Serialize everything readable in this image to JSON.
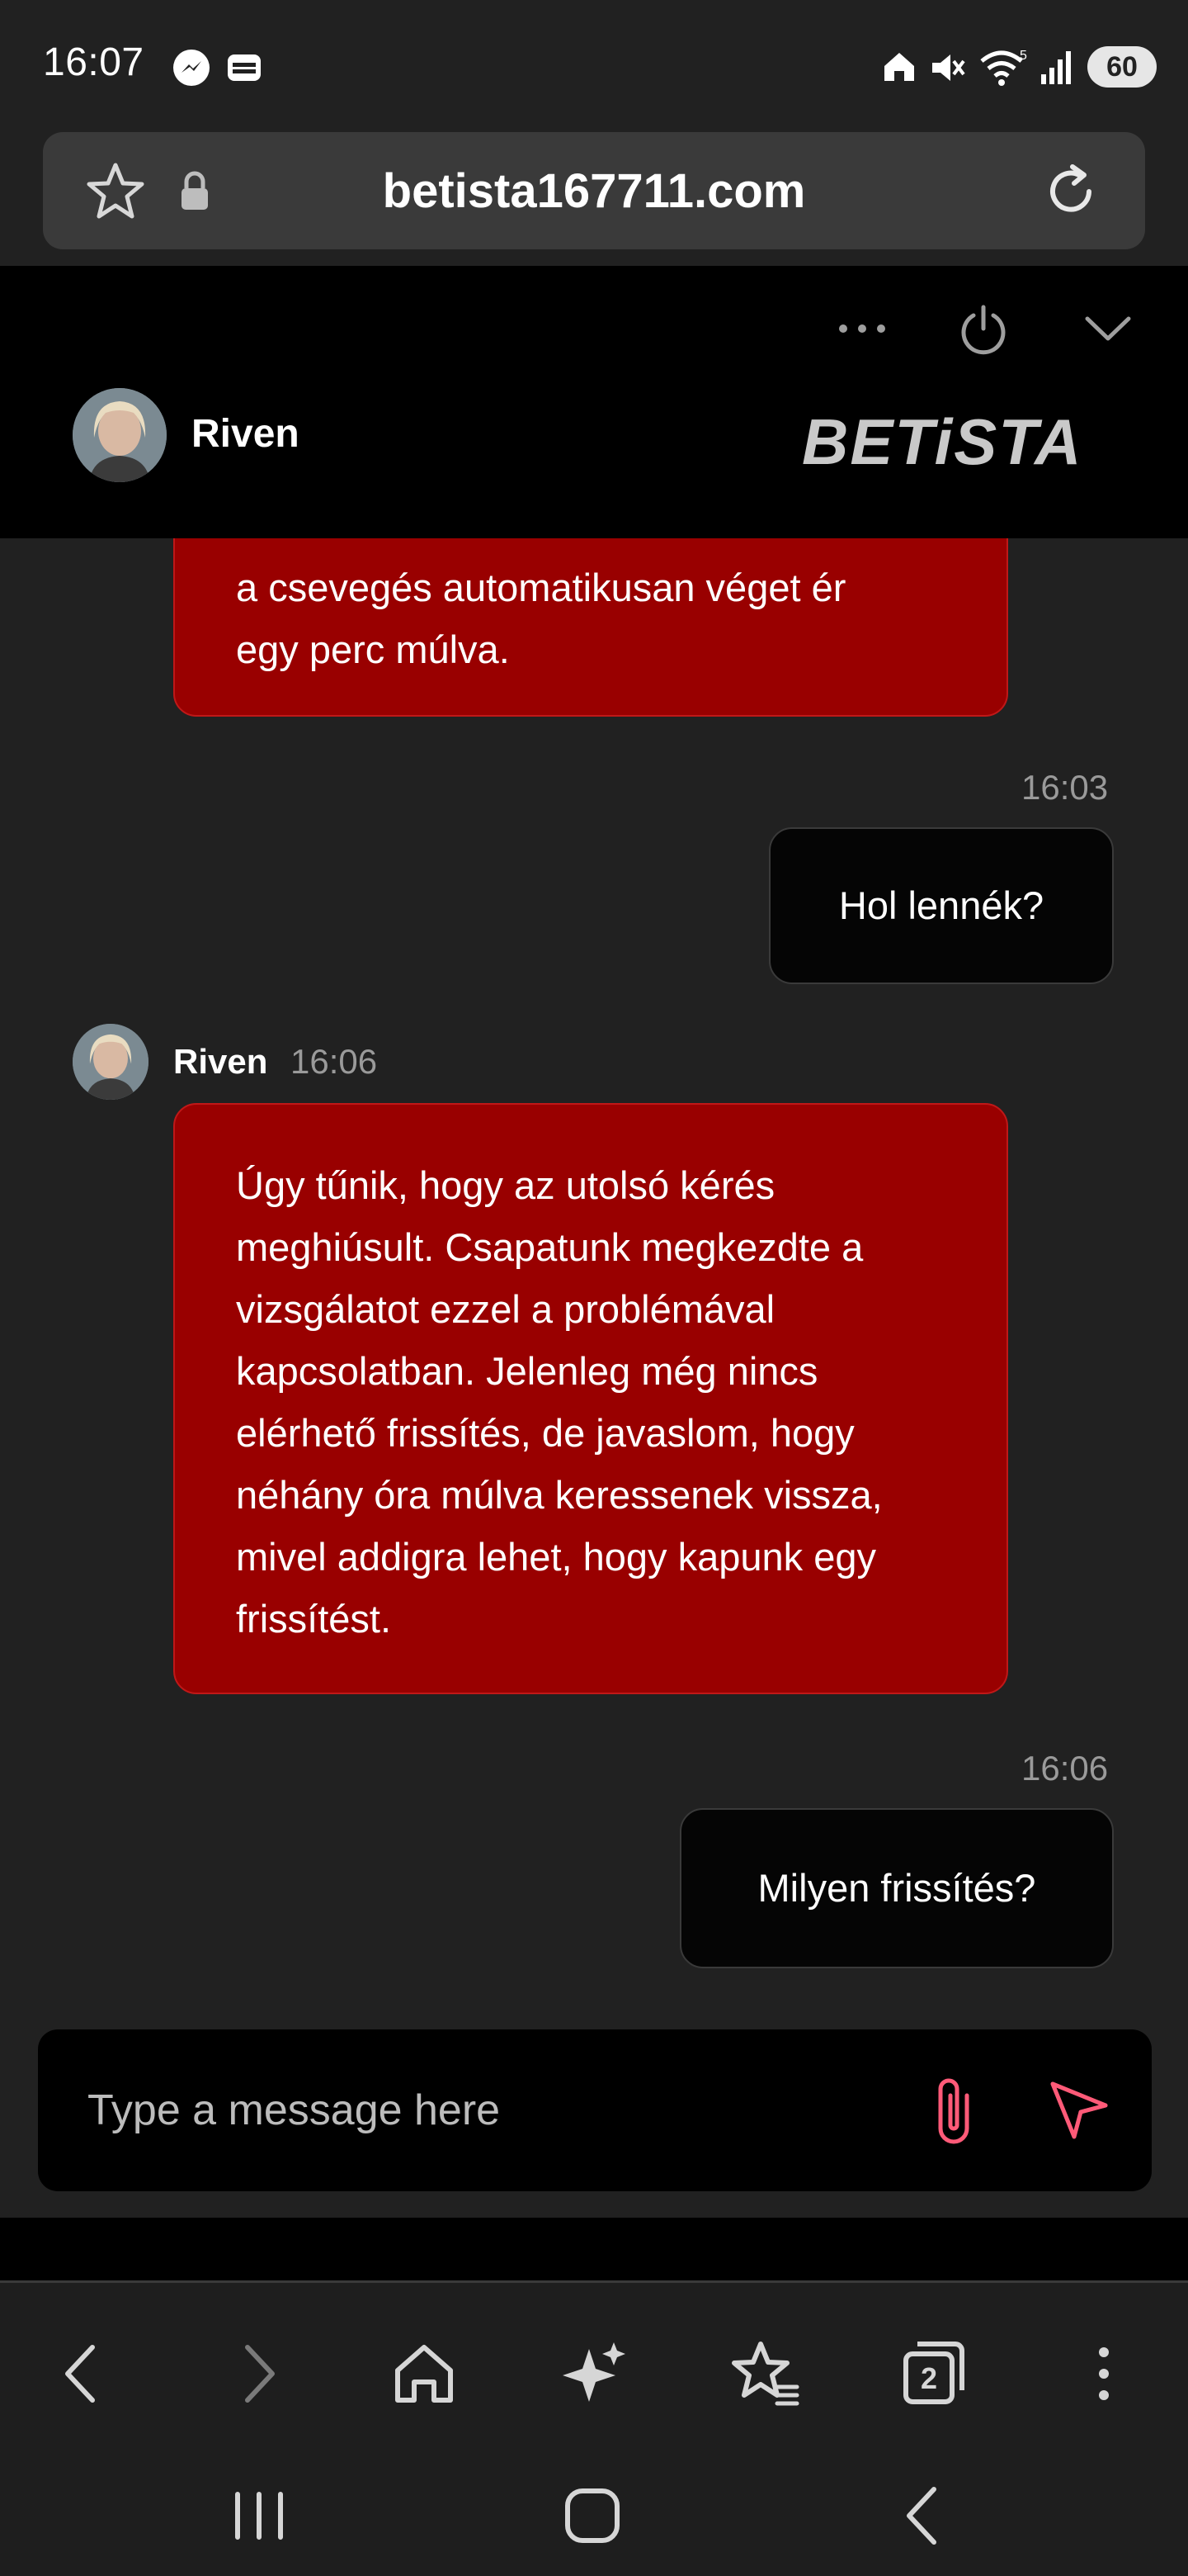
{
  "status_bar": {
    "time": "16:07",
    "battery": "60"
  },
  "browser": {
    "url": "betista167711.com"
  },
  "chat_header": {
    "agent_name": "Riven",
    "brand": "BETiSTA"
  },
  "messages": [
    {
      "type": "bot",
      "text_lines": [
        "a csevegés automatikusan véget ér",
        "egy perc múlva."
      ]
    },
    {
      "type": "user",
      "time": "16:03",
      "text": "Hol lennék?"
    },
    {
      "type": "bot",
      "sender": "Riven",
      "time": "16:06",
      "text_lines": [
        "Úgy tűnik, hogy az utolsó kérés",
        "meghiúsult. Csapatunk megkezdte a",
        "vizsgálatot ezzel a problémával",
        "kapcsolatban. Jelenleg még nincs",
        "elérhető frissítés, de javaslom, hogy",
        "néhány óra múlva keressenek vissza,",
        "mivel addigra lehet, hogy kapunk egy",
        "frissítést."
      ]
    },
    {
      "type": "user",
      "time": "16:06",
      "text": "Milyen frissítés?"
    }
  ],
  "composer": {
    "placeholder": "Type a message here"
  },
  "colors": {
    "bot_bubble": "#990000",
    "accent_icon": "#ff4d6d"
  },
  "icons": {
    "header": [
      "more-icon",
      "power-icon",
      "chevron-down-icon"
    ],
    "browser_nav": [
      "back-icon",
      "forward-icon",
      "home-icon",
      "ai-sparkle-icon",
      "bookmarks-icon",
      "tabs-icon",
      "menu-icon"
    ],
    "tabs_count": "2"
  }
}
